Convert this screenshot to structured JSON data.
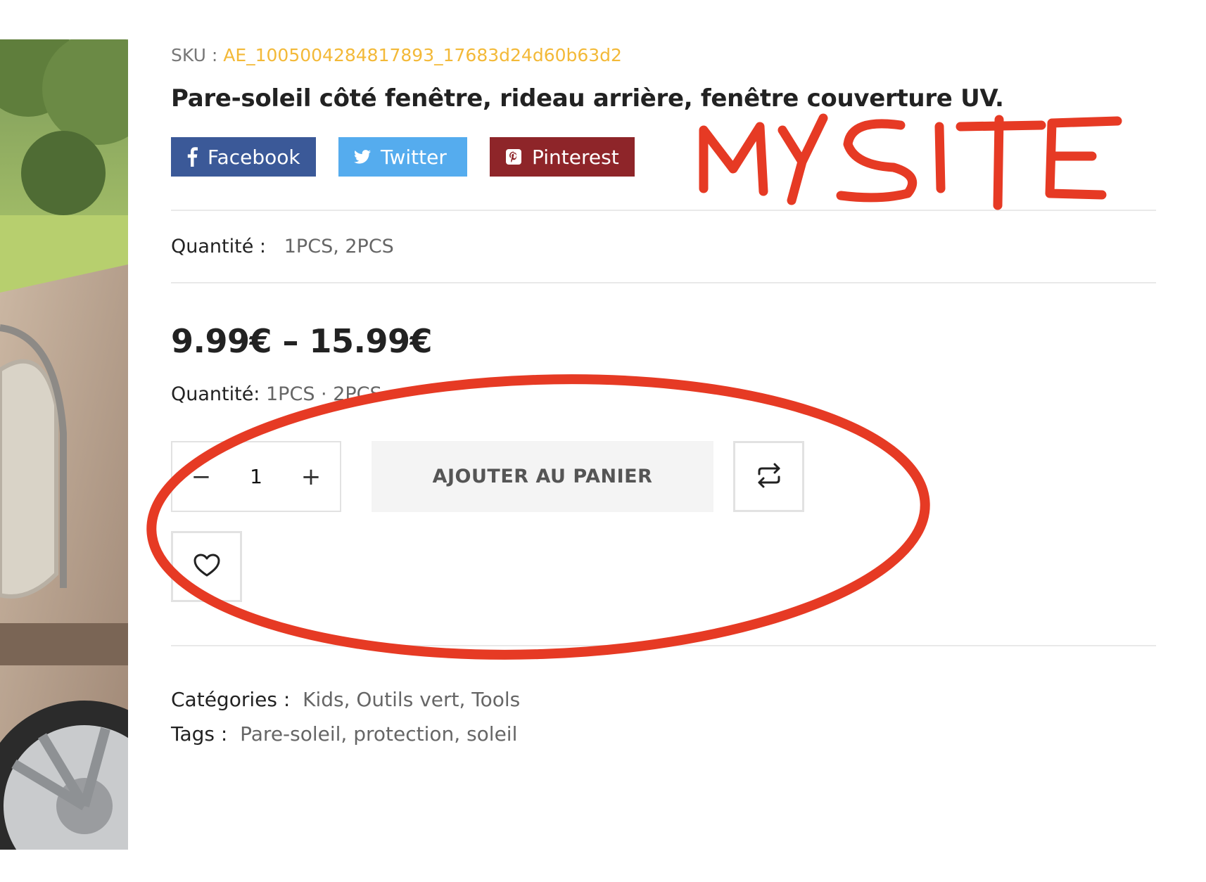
{
  "sku": {
    "label": "SKU :",
    "value": "AE_1005004284817893_17683d24d60b63d2"
  },
  "product": {
    "title": "Pare-soleil côté fenêtre, rideau arrière, fenêtre couverture UV."
  },
  "share": {
    "facebook": "Facebook",
    "twitter": "Twitter",
    "pinterest": "Pinterest"
  },
  "attributes": {
    "quantity_label": "Quantité :",
    "quantity_value": "1PCS, 2PCS"
  },
  "price": {
    "range": "9.99€ – 15.99€"
  },
  "variation": {
    "label": "Quantité:",
    "options": "1PCS · 2PCS"
  },
  "cart": {
    "minus": "−",
    "quantity": "1",
    "plus": "+",
    "add_label": "AJOUTER AU PANIER"
  },
  "meta": {
    "categories_label": "Catégories :",
    "categories": "Kids, Outils vert, Tools",
    "tags_label": "Tags :",
    "tags": "Pare-soleil, protection, soleil"
  },
  "annotation": {
    "handwritten": "MY SITE",
    "color": "#e63a24"
  },
  "colors": {
    "accent": "#f3b938",
    "facebook": "#3b5998",
    "twitter": "#55acee",
    "pinterest": "#8e2529"
  },
  "icons": {
    "facebook": "facebook-icon",
    "twitter": "twitter-icon",
    "pinterest": "pinterest-icon",
    "compare": "compare-icon",
    "wishlist": "heart-icon"
  }
}
